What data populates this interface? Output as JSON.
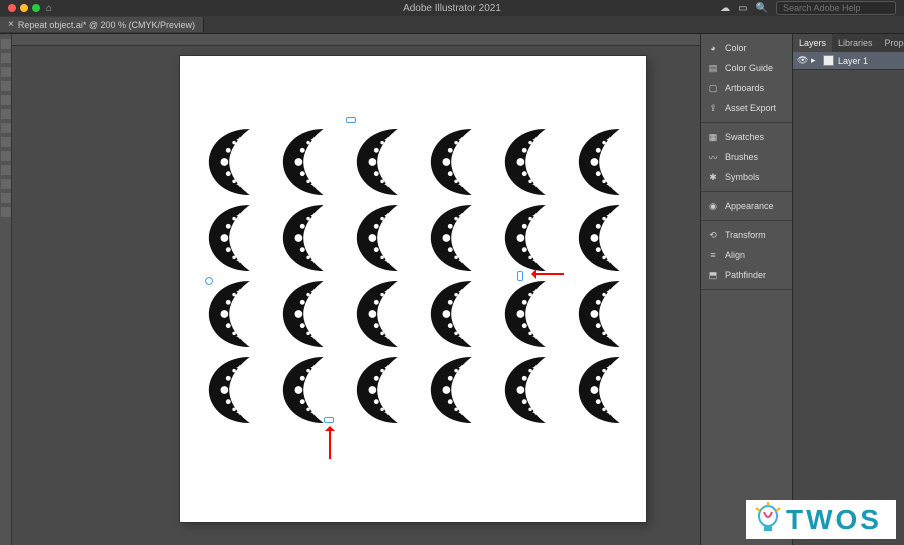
{
  "app_title": "Adobe Illustrator 2021",
  "search_placeholder": "Search Adobe Help",
  "document_tab": {
    "label": "Repeat object.ai* @ 200 % (CMYK/Preview)"
  },
  "dock_panel": {
    "group1": [
      {
        "name": "color-icon",
        "label": "Color"
      },
      {
        "name": "color-guide-icon",
        "label": "Color Guide"
      },
      {
        "name": "artboards-icon",
        "label": "Artboards"
      },
      {
        "name": "asset-export-icon",
        "label": "Asset Export"
      }
    ],
    "group2": [
      {
        "name": "swatches-icon",
        "label": "Swatches"
      },
      {
        "name": "brushes-icon",
        "label": "Brushes"
      },
      {
        "name": "symbols-icon",
        "label": "Symbols"
      }
    ],
    "group3": [
      {
        "name": "appearance-icon",
        "label": "Appearance"
      }
    ],
    "group4": [
      {
        "name": "transform-icon",
        "label": "Transform"
      },
      {
        "name": "align-icon",
        "label": "Align"
      },
      {
        "name": "pathfinder-icon",
        "label": "Pathfinder"
      }
    ]
  },
  "layers_panel": {
    "tabs": [
      "Layers",
      "Libraries",
      "Properties"
    ],
    "active_tab": "Layers",
    "layers": [
      {
        "name": "Layer 1"
      }
    ]
  },
  "repeat_grid": {
    "rows": 4,
    "cols": 6
  },
  "watermark": "TWOS",
  "colors": {
    "ui_bg": "#4a4a4a",
    "panel_bg": "#535353",
    "selection": "#4b9de6",
    "arrow": "#ff0000",
    "brand": "#1c98b7"
  },
  "zoom": "200 %",
  "color_mode": "CMYK",
  "view_mode": "Preview"
}
